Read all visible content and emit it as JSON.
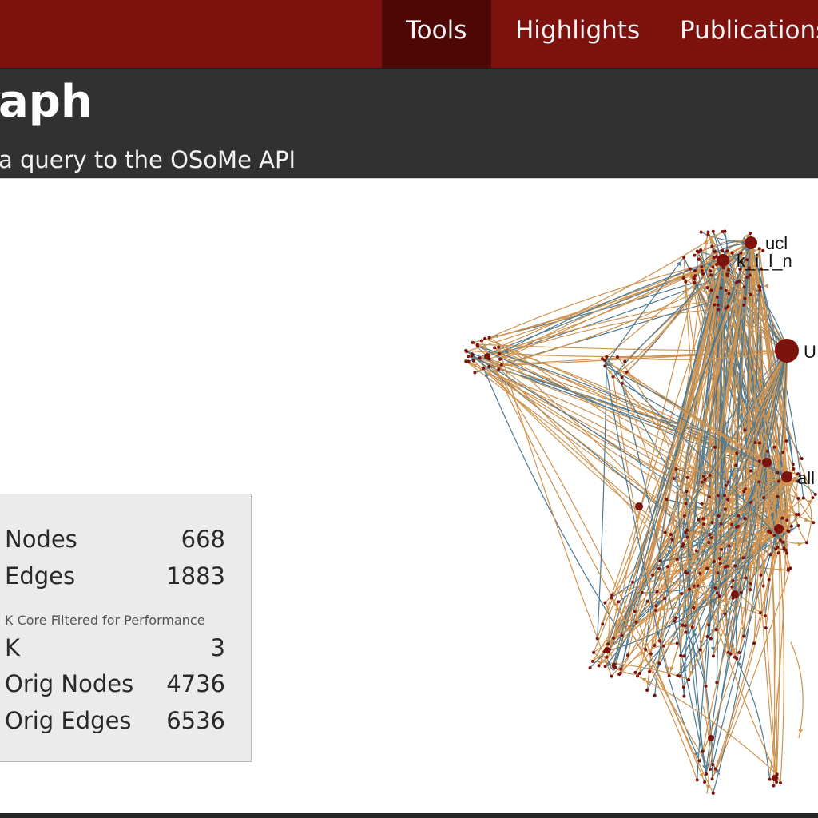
{
  "nav": {
    "items": [
      {
        "label": "Tools",
        "active": true
      },
      {
        "label": "Highlights",
        "active": false
      },
      {
        "label": "Publications",
        "active": false
      }
    ]
  },
  "header": {
    "title": "aph",
    "subtitle": "a query to the OSoMe API"
  },
  "stats": {
    "nodes_label": "Nodes",
    "nodes_value": "668",
    "edges_label": "Edges",
    "edges_value": "1883",
    "note": "K Core Filtered for Performance",
    "k_label": "K",
    "k_value": "3",
    "orig_nodes_label": "Orig Nodes",
    "orig_nodes_value": "4736",
    "orig_edges_label": "Orig Edges",
    "orig_edges_value": "6536"
  },
  "graph": {
    "labels": {
      "ucl": "ucl",
      "kiln": "k_i_l_n",
      "u": "U",
      "all": "all"
    },
    "colors": {
      "edge_orange": "#d0934f",
      "edge_blue": "#4d7a93",
      "node": "#7d130d"
    }
  }
}
